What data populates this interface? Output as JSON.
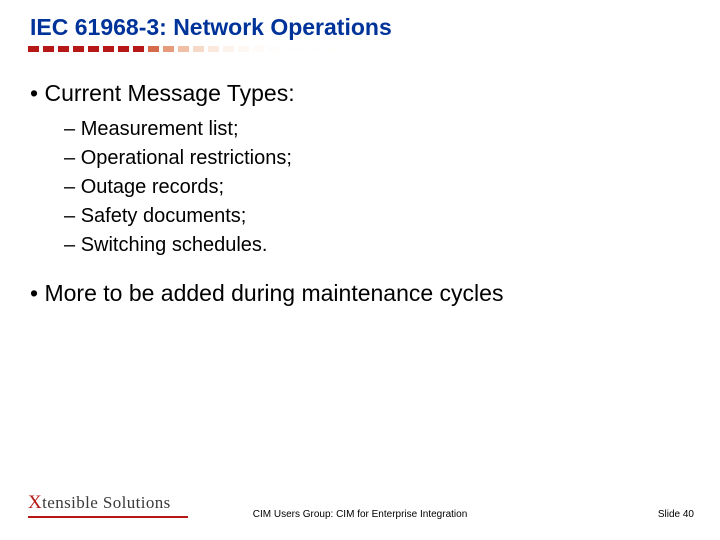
{
  "title": "IEC 61968-3: Network Operations",
  "dash_colors": [
    "#b51816",
    "#b51816",
    "#b51816",
    "#b51816",
    "#b51816",
    "#b51816",
    "#b51816",
    "#b51816",
    "#d66b4c",
    "#e69b7a",
    "#f0bfa6",
    "#f7d9c8",
    "#fbe9de",
    "#fdf2ec",
    "#fef8f4",
    "#fffbf9",
    "#fffdfb",
    "#fffefc",
    "#fffefd",
    "#fffefe",
    "#fffffe",
    "#ffffff"
  ],
  "bullets": [
    {
      "text": "Current Message Types:",
      "sub": [
        "Measurement list;",
        "Operational restrictions;",
        "Outage records;",
        "Safety documents;",
        "Switching schedules."
      ]
    },
    {
      "text": "More to be added during maintenance cycles",
      "sub": []
    }
  ],
  "logo": {
    "x": "X",
    "rest": "tensible Solutions"
  },
  "footer_center": "CIM Users Group: CIM for Enterprise Integration",
  "footer_right": "Slide 40"
}
